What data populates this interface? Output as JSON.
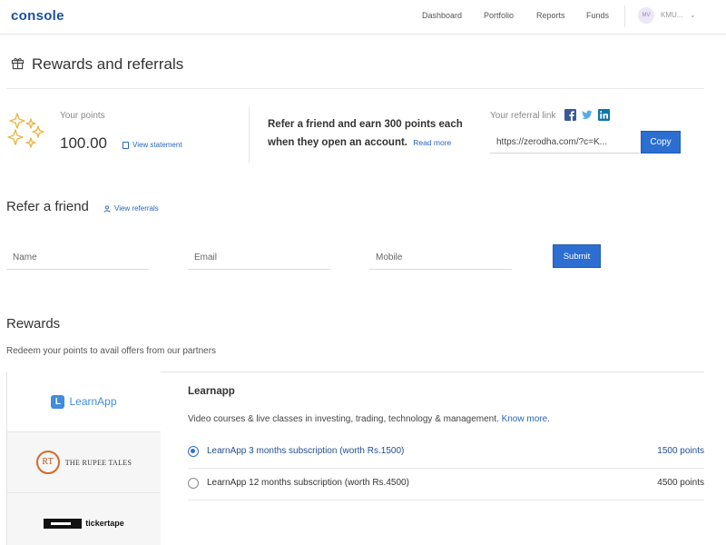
{
  "header": {
    "logo": "console",
    "nav": [
      {
        "label": "Dashboard"
      },
      {
        "label": "Portfolio"
      },
      {
        "label": "Reports"
      },
      {
        "label": "Funds"
      }
    ],
    "avatar_initials": "MV",
    "user_id": "KMU..."
  },
  "page": {
    "title": "Rewards and referrals"
  },
  "points": {
    "label": "Your points",
    "value": "100.00",
    "statement_link": "View statement"
  },
  "refer_promo": {
    "text": "Refer a friend and earn 300 points each when they open an account.",
    "read_more": "Read more"
  },
  "referral_link": {
    "label": "Your referral link",
    "social_icons": [
      "facebook-icon",
      "twitter-icon",
      "linkedin-icon"
    ],
    "url": "https://zerodha.com/?c=K...",
    "copy_label": "Copy"
  },
  "refer_friend": {
    "title": "Refer a friend",
    "view_referrals": "View referrals",
    "name_placeholder": "Name",
    "email_placeholder": "Email",
    "mobile_placeholder": "Mobile",
    "submit_label": "Submit"
  },
  "rewards": {
    "title": "Rewards",
    "subtitle": "Redeem your points to avail offers from our partners",
    "partners": [
      {
        "name": "LearnApp",
        "badge": "L"
      },
      {
        "name": "THE RUPEE TALES",
        "badge": "RT"
      },
      {
        "name": "tickertape"
      }
    ],
    "selected_partner": {
      "name": "Learnapp",
      "description": "Video courses & live classes in investing, trading, technology & management.",
      "know_more": "Know more.",
      "options": [
        {
          "label": "LearnApp 3 months subscription (worth Rs.1500)",
          "points": "1500 points",
          "selected": true
        },
        {
          "label": "LearnApp 12 months subscription (worth Rs.4500)",
          "points": "4500 points",
          "selected": false
        }
      ]
    }
  },
  "colors": {
    "primary": "#2c6fd0",
    "link": "#2866b8",
    "logo": "#1a4fa0",
    "gold": "#e8b84a"
  }
}
